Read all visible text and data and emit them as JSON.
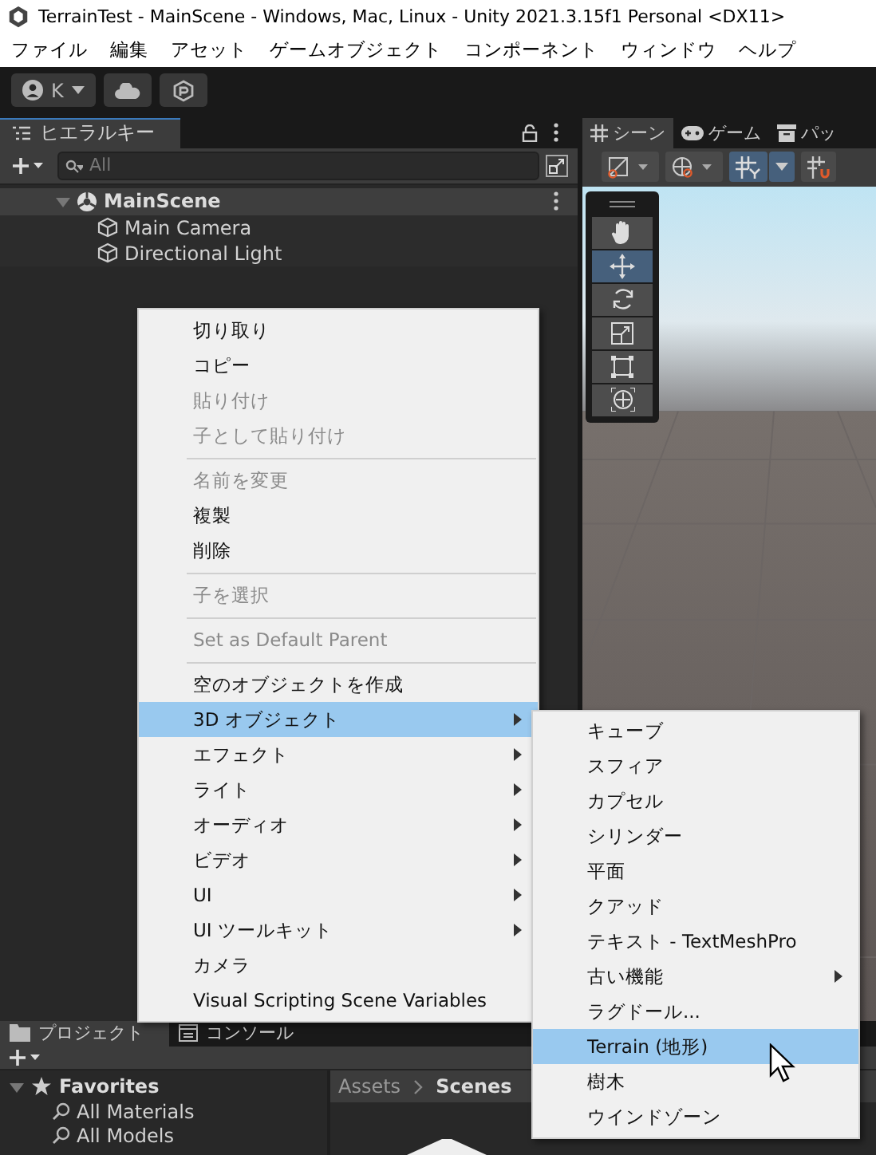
{
  "window": {
    "title": "TerrainTest - MainScene - Windows, Mac, Linux - Unity 2021.3.15f1 Personal <DX11>"
  },
  "menu_bar": [
    "ファイル",
    "編集",
    "アセット",
    "ゲームオブジェクト",
    "コンポーネント",
    "ウィンドウ",
    "ヘルプ"
  ],
  "toolbar": {
    "account": "K"
  },
  "hierarchy": {
    "tab": "ヒエラルキー",
    "search": {
      "placeholder": "All"
    },
    "scene": {
      "name": "MainScene",
      "expanded": true
    },
    "items": [
      {
        "name": "Main Camera"
      },
      {
        "name": "Directional Light"
      }
    ]
  },
  "scene_view": {
    "tabs": [
      {
        "label": "シーン",
        "selected": true
      },
      {
        "label": "ゲーム",
        "selected": false
      },
      {
        "label": "パッ",
        "selected": false
      }
    ],
    "tools": [
      {
        "kind": "hand",
        "selected": false
      },
      {
        "kind": "move",
        "selected": true
      },
      {
        "kind": "rotate",
        "selected": false
      },
      {
        "kind": "scale",
        "selected": false
      },
      {
        "kind": "rect",
        "selected": false
      },
      {
        "kind": "transform",
        "selected": false
      }
    ]
  },
  "context_menu": {
    "items": [
      {
        "kind": "item",
        "label": "切り取り",
        "disabled": false,
        "selected": false,
        "submenu": false
      },
      {
        "kind": "item",
        "label": "コピー",
        "disabled": false,
        "selected": false,
        "submenu": false
      },
      {
        "kind": "item",
        "label": "貼り付け",
        "disabled": true,
        "selected": false,
        "submenu": false
      },
      {
        "kind": "item",
        "label": "子として貼り付け",
        "disabled": true,
        "selected": false,
        "submenu": false
      },
      {
        "kind": "separator"
      },
      {
        "kind": "item",
        "label": "名前を変更",
        "disabled": true,
        "selected": false,
        "submenu": false
      },
      {
        "kind": "item",
        "label": "複製",
        "disabled": false,
        "selected": false,
        "submenu": false
      },
      {
        "kind": "item",
        "label": "削除",
        "disabled": false,
        "selected": false,
        "submenu": false
      },
      {
        "kind": "separator"
      },
      {
        "kind": "item",
        "label": "子を選択",
        "disabled": true,
        "selected": false,
        "submenu": false
      },
      {
        "kind": "separator"
      },
      {
        "kind": "item",
        "label": "Set as Default Parent",
        "disabled": true,
        "selected": false,
        "submenu": false
      },
      {
        "kind": "separator"
      },
      {
        "kind": "item",
        "label": "空のオブジェクトを作成",
        "disabled": false,
        "selected": false,
        "submenu": false
      },
      {
        "kind": "item",
        "label": "3D オブジェクト",
        "disabled": false,
        "selected": true,
        "submenu": true
      },
      {
        "kind": "item",
        "label": "エフェクト",
        "disabled": false,
        "selected": false,
        "submenu": true
      },
      {
        "kind": "item",
        "label": "ライト",
        "disabled": false,
        "selected": false,
        "submenu": true
      },
      {
        "kind": "item",
        "label": "オーディオ",
        "disabled": false,
        "selected": false,
        "submenu": true
      },
      {
        "kind": "item",
        "label": "ビデオ",
        "disabled": false,
        "selected": false,
        "submenu": true
      },
      {
        "kind": "item",
        "label": "UI",
        "disabled": false,
        "selected": false,
        "submenu": true
      },
      {
        "kind": "item",
        "label": "UI ツールキット",
        "disabled": false,
        "selected": false,
        "submenu": true
      },
      {
        "kind": "item",
        "label": "カメラ",
        "disabled": false,
        "selected": false,
        "submenu": false
      },
      {
        "kind": "item",
        "label": "Visual Scripting Scene Variables",
        "disabled": false,
        "selected": false,
        "submenu": false
      }
    ]
  },
  "submenu": {
    "items": [
      {
        "label": "キューブ",
        "selected": false,
        "submenu": false
      },
      {
        "label": "スフィア",
        "selected": false,
        "submenu": false
      },
      {
        "label": "カプセル",
        "selected": false,
        "submenu": false
      },
      {
        "label": "シリンダー",
        "selected": false,
        "submenu": false
      },
      {
        "label": "平面",
        "selected": false,
        "submenu": false
      },
      {
        "label": "クアッド",
        "selected": false,
        "submenu": false
      },
      {
        "label": "テキスト - TextMeshPro",
        "selected": false,
        "submenu": false
      },
      {
        "label": "古い機能",
        "selected": false,
        "submenu": true
      },
      {
        "label": "ラグドール...",
        "selected": false,
        "submenu": false
      },
      {
        "label": "Terrain (地形)",
        "selected": true,
        "submenu": false
      },
      {
        "label": "樹木",
        "selected": false,
        "submenu": false
      },
      {
        "label": "ウインドゾーン",
        "selected": false,
        "submenu": false
      }
    ]
  },
  "project": {
    "tabs": [
      {
        "label": "プロジェクト",
        "selected": true
      },
      {
        "label": "コンソール",
        "selected": false
      }
    ],
    "favorites": {
      "label": "Favorites",
      "expanded": true,
      "items": [
        "All Materials",
        "All Models"
      ]
    },
    "breadcrumb": [
      "Assets",
      "Scenes"
    ]
  }
}
